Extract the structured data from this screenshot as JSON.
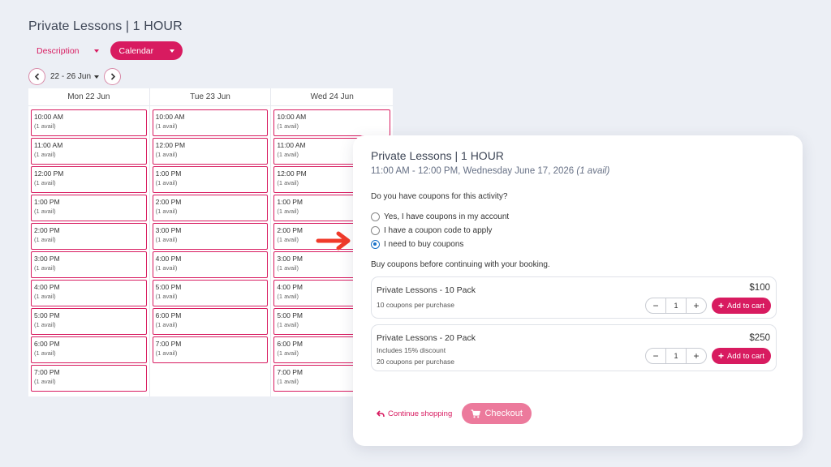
{
  "page": {
    "title": "Private Lessons | 1 HOUR"
  },
  "tabs": {
    "description": "Description",
    "calendar": "Calendar"
  },
  "week": {
    "label": "22 - 26 Jun"
  },
  "calendar": {
    "days": [
      {
        "label": "Mon 22 Jun",
        "slots": [
          {
            "time": "10:00 AM",
            "avail": "(1 avail)"
          },
          {
            "time": "11:00 AM",
            "avail": "(1 avail)"
          },
          {
            "time": "12:00 PM",
            "avail": "(1 avail)"
          },
          {
            "time": "1:00 PM",
            "avail": "(1 avail)"
          },
          {
            "time": "2:00 PM",
            "avail": "(1 avail)"
          },
          {
            "time": "3:00 PM",
            "avail": "(1 avail)"
          },
          {
            "time": "4:00 PM",
            "avail": "(1 avail)"
          },
          {
            "time": "5:00 PM",
            "avail": "(1 avail)"
          },
          {
            "time": "6:00 PM",
            "avail": "(1 avail)"
          },
          {
            "time": "7:00 PM",
            "avail": "(1 avail)"
          }
        ]
      },
      {
        "label": "Tue 23 Jun",
        "slots": [
          {
            "time": "10:00 AM",
            "avail": "(1 avail)"
          },
          {
            "time": "12:00 PM",
            "avail": "(1 avail)"
          },
          {
            "time": "1:00 PM",
            "avail": "(1 avail)"
          },
          {
            "time": "2:00 PM",
            "avail": "(1 avail)"
          },
          {
            "time": "3:00 PM",
            "avail": "(1 avail)"
          },
          {
            "time": "4:00 PM",
            "avail": "(1 avail)"
          },
          {
            "time": "5:00 PM",
            "avail": "(1 avail)"
          },
          {
            "time": "6:00 PM",
            "avail": "(1 avail)"
          },
          {
            "time": "7:00 PM",
            "avail": "(1 avail)"
          }
        ]
      },
      {
        "label": "Wed 24 Jun",
        "slots": [
          {
            "time": "10:00 AM",
            "avail": "(1 avail)"
          },
          {
            "time": "11:00 AM",
            "avail": "(1 avail)"
          },
          {
            "time": "12:00 PM",
            "avail": "(1 avail)"
          },
          {
            "time": "1:00 PM",
            "avail": "(1 avail)"
          },
          {
            "time": "2:00 PM",
            "avail": "(1 avail)"
          },
          {
            "time": "3:00 PM",
            "avail": "(1 avail)"
          },
          {
            "time": "4:00 PM",
            "avail": "(1 avail)"
          },
          {
            "time": "5:00 PM",
            "avail": "(1 avail)"
          },
          {
            "time": "6:00 PM",
            "avail": "(1 avail)"
          },
          {
            "time": "7:00 PM",
            "avail": "(1 avail)"
          }
        ]
      }
    ]
  },
  "modal": {
    "title": "Private Lessons | 1 HOUR",
    "time_range": "11:00 AM - 12:00 PM, Wednesday June 17, 2026",
    "avail": "(1 avail)",
    "question": "Do you have coupons for this activity?",
    "options": [
      {
        "label": "Yes, I have coupons in my account",
        "checked": false
      },
      {
        "label": "I have a coupon code to apply",
        "checked": false
      },
      {
        "label": "I need to buy coupons",
        "checked": true
      }
    ],
    "buy_text": "Buy coupons before continuing with your booking.",
    "packs": [
      {
        "name": "Private Lessons - 10 Pack",
        "desc": [
          "10 coupons per purchase"
        ],
        "price": "$100",
        "qty": "1",
        "add_label": "Add to cart"
      },
      {
        "name": "Private Lessons - 20 Pack",
        "desc": [
          "Includes 15% discount",
          "20 coupons per purchase"
        ],
        "price": "$250",
        "qty": "1",
        "add_label": "Add to cart"
      }
    ],
    "continue_label": "Continue shopping",
    "checkout_label": "Checkout"
  },
  "icons": {
    "prev": "chevron-left-icon",
    "next": "chevron-right-icon",
    "arrow": "pointer-arrow-icon",
    "undo": "undo-arrow-icon",
    "cart": "cart-icon"
  },
  "colors": {
    "accent": "#d81b60",
    "checkout": "#ec7a9c",
    "arrow": "#f03a2a",
    "radio": "#1a73c8",
    "background": "#eceff5"
  }
}
